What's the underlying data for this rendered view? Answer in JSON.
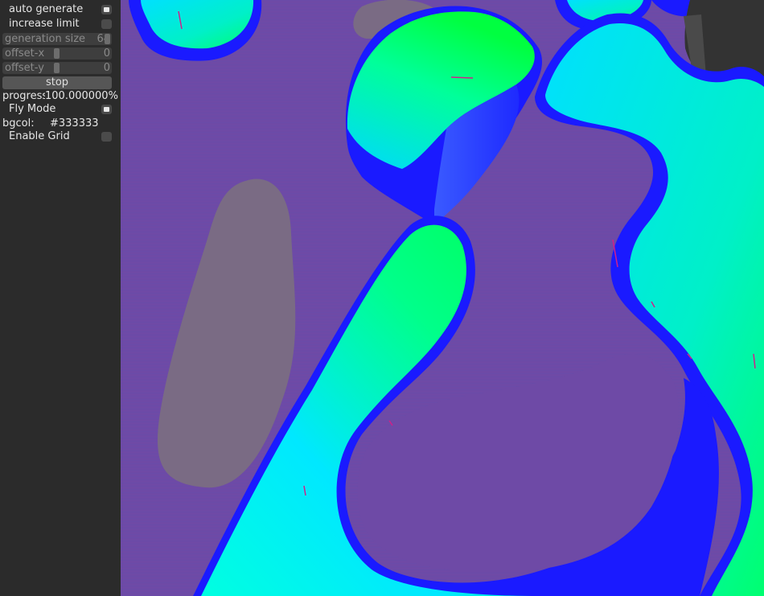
{
  "panel": {
    "auto_generate": {
      "label": "auto generate",
      "checked": true
    },
    "increase_limit": {
      "label": "increase limit",
      "checked": false
    },
    "generation_size": {
      "label": "generation size",
      "value": "64"
    },
    "offset_x": {
      "label": "offset-x",
      "value": "0"
    },
    "offset_y": {
      "label": "offset-y",
      "value": "0"
    },
    "stop_button": "stop",
    "progress": {
      "label": "progress",
      "value": "100.000000%"
    },
    "fly_mode": {
      "label": "Fly Mode",
      "checked": true
    },
    "bgcol": {
      "label": "bgcol:",
      "value": "#333333"
    },
    "enable_grid": {
      "label": "Enable Grid",
      "checked": false
    }
  },
  "colors": {
    "background": "#333333",
    "panel": "#2b2b2b",
    "terrain_low": "#6e4aa6",
    "terrain_edge": "#1a1aff",
    "terrain_mid": "#00e5ff",
    "terrain_high": "#00ff5a"
  }
}
